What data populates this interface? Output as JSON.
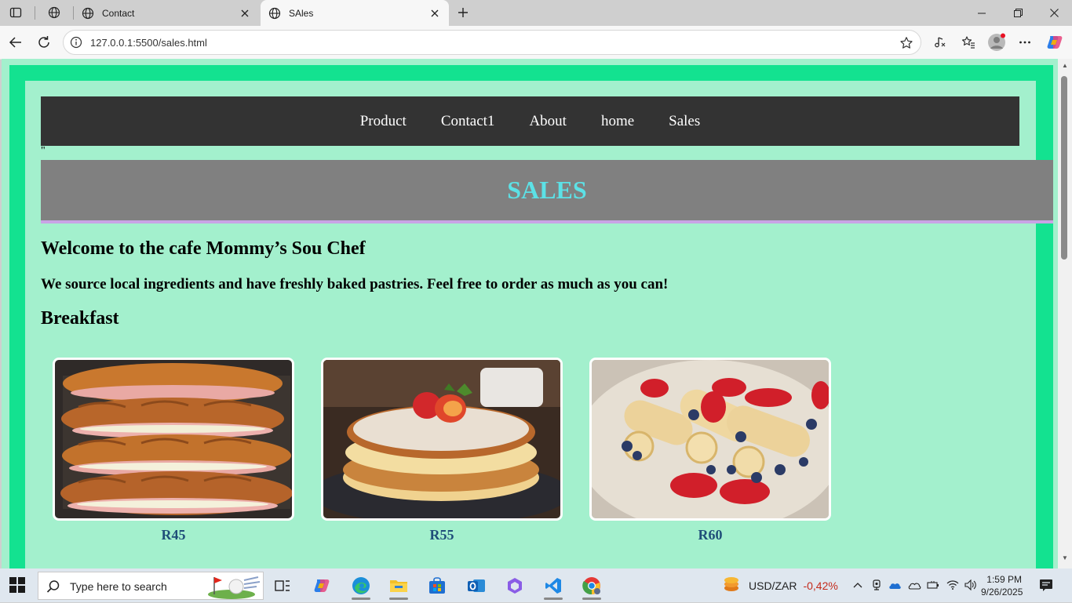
{
  "browser": {
    "tabs": [
      {
        "title": "Contact"
      },
      {
        "title": "SAles"
      }
    ],
    "url": "127.0.0.1:5500/sales.html"
  },
  "page": {
    "nav": [
      "Product",
      "Contact1",
      "About",
      "home",
      "Sales"
    ],
    "stray_text": "\"",
    "banner_title": "SALES",
    "welcome": "Welcome to the cafe Mommy’s Sou Chef",
    "intro": "We source local ingredients and have freshly baked pastries. Feel free to order as much as you can!",
    "section_title": "Breakfast",
    "items": [
      {
        "image": "croissant sandwiches with ham and cheese",
        "price": "R45"
      },
      {
        "image": "pancakes with strawberries",
        "price": "R55"
      },
      {
        "image": "crepes with strawberries and blueberries",
        "price": "R60"
      }
    ],
    "colors": {
      "page_bg": "#a3f0cd",
      "frame": "#13e290",
      "navbar": "#333333",
      "banner": "#808080",
      "banner_text": "#5ce1e6",
      "banner_border": "#c9a3e6",
      "price_text": "#1f4e79"
    }
  },
  "taskbar": {
    "search_placeholder": "Type here to search",
    "ticker_label": "USD/ZAR",
    "ticker_change": "-0,42%",
    "time": "1:59 PM",
    "date": "9/26/2025"
  }
}
